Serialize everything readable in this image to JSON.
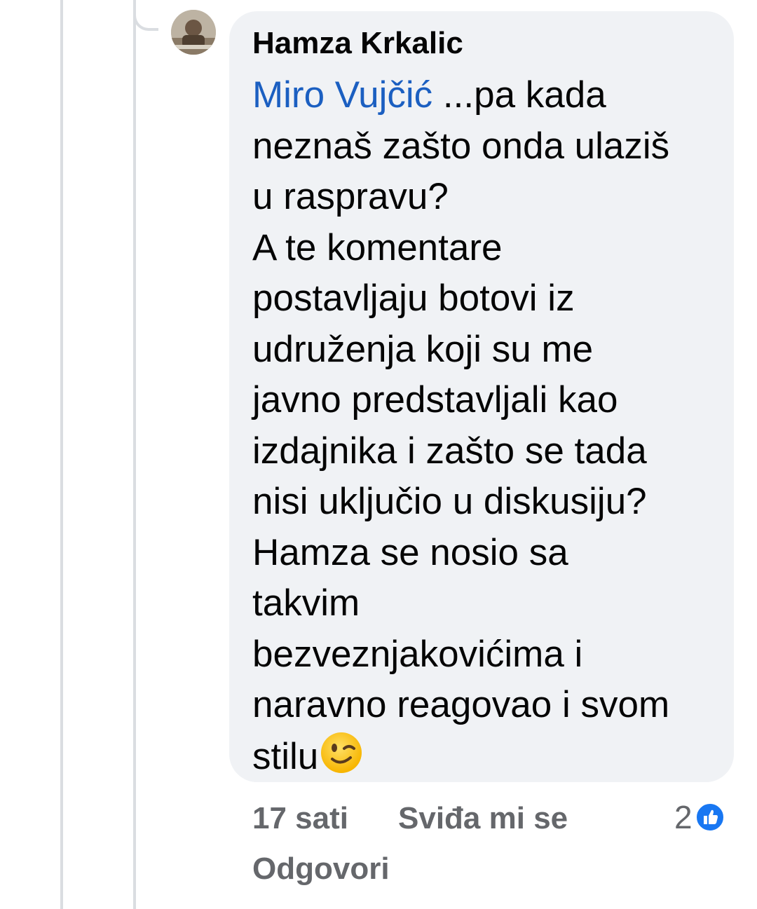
{
  "comment": {
    "author": "Hamza Krkalic",
    "mention": "Miro Vujčić",
    "text_lines": [
      " ...pa kada",
      "neznaš zašto onda ulaziš",
      "u raspravu?",
      "A te komentare",
      "postavljaju botovi iz",
      "udruženja koji su me",
      "javno predstavljali kao",
      "izdajnika i zašto se tada",
      "nisi uključio u diskusiju?",
      "Hamza se nosio sa",
      "takvim",
      "bezveznjakovićima i",
      "naravno reagovao i svom",
      "stilu"
    ],
    "emoji": "winking-face-emoji"
  },
  "meta": {
    "time": "17 sati",
    "like_label": "Sviđa mi se",
    "reply_label": "Odgovori",
    "reaction_count": "2",
    "reaction_icon": "like-icon"
  },
  "colors": {
    "bubble": "#f0f2f5",
    "mention": "#1b5fc1",
    "meta_text": "#65676b",
    "like_blue": "#1877f2"
  }
}
